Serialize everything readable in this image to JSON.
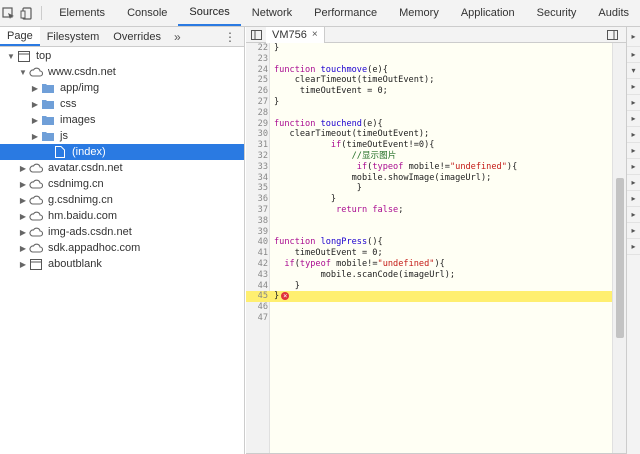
{
  "toolbar": {
    "icons": [
      "inspect-icon",
      "device-icon"
    ],
    "tabs": [
      "Elements",
      "Console",
      "Sources",
      "Network",
      "Performance",
      "Memory",
      "Application",
      "Security",
      "Audits"
    ],
    "active_tab": "Sources"
  },
  "navigator": {
    "subtabs": [
      "Page",
      "Filesystem",
      "Overrides"
    ],
    "active_subtab": "Page",
    "more": "»",
    "menu": "⋮",
    "tree": [
      {
        "label": "top",
        "depth": 0,
        "expanded": true,
        "icon": "frame-icon"
      },
      {
        "label": "www.csdn.net",
        "depth": 1,
        "expanded": true,
        "icon": "cloud-icon"
      },
      {
        "label": "app/img",
        "depth": 2,
        "expanded": false,
        "icon": "folder-icon"
      },
      {
        "label": "css",
        "depth": 2,
        "expanded": false,
        "icon": "folder-icon"
      },
      {
        "label": "images",
        "depth": 2,
        "expanded": false,
        "icon": "folder-icon"
      },
      {
        "label": "js",
        "depth": 2,
        "expanded": false,
        "icon": "folder-icon"
      },
      {
        "label": "(index)",
        "depth": 3,
        "expanded": null,
        "icon": "file-icon",
        "selected": true
      },
      {
        "label": "avatar.csdn.net",
        "depth": 1,
        "expanded": false,
        "icon": "cloud-icon"
      },
      {
        "label": "csdnimg.cn",
        "depth": 1,
        "expanded": false,
        "icon": "cloud-icon"
      },
      {
        "label": "g.csdnimg.cn",
        "depth": 1,
        "expanded": false,
        "icon": "cloud-icon"
      },
      {
        "label": "hm.baidu.com",
        "depth": 1,
        "expanded": false,
        "icon": "cloud-icon"
      },
      {
        "label": "img-ads.csdn.net",
        "depth": 1,
        "expanded": false,
        "icon": "cloud-icon"
      },
      {
        "label": "sdk.appadhoc.com",
        "depth": 1,
        "expanded": false,
        "icon": "cloud-icon"
      },
      {
        "label": "aboutblank",
        "depth": 1,
        "expanded": false,
        "icon": "frame-icon"
      }
    ]
  },
  "editor": {
    "file_tab": "VM756",
    "close": "×",
    "lines": [
      {
        "n": "22",
        "code": "}"
      },
      {
        "n": "23",
        "code": ""
      },
      {
        "n": "24",
        "code": "function touchmove(e){"
      },
      {
        "n": "25",
        "code": "    clearTimeout(timeOutEvent);"
      },
      {
        "n": "26",
        "code": "     timeOutEvent = 0;"
      },
      {
        "n": "27",
        "code": "}"
      },
      {
        "n": "28",
        "code": ""
      },
      {
        "n": "29",
        "code": "function touchend(e){"
      },
      {
        "n": "30",
        "code": "   clearTimeout(timeOutEvent);"
      },
      {
        "n": "31",
        "code": "           if(timeOutEvent!=0){"
      },
      {
        "n": "32",
        "code": "               //显示图片"
      },
      {
        "n": "33",
        "code": "                if(typeof mobile!=\"undefined\"){"
      },
      {
        "n": "34",
        "code": "               mobile.showImage(imageUrl);"
      },
      {
        "n": "35",
        "code": "                }"
      },
      {
        "n": "36",
        "code": "           }"
      },
      {
        "n": "37",
        "code": "            return false;"
      },
      {
        "n": "38",
        "code": ""
      },
      {
        "n": "39",
        "code": ""
      },
      {
        "n": "40",
        "code": "function longPress(){"
      },
      {
        "n": "41",
        "code": "    timeOutEvent = 0;"
      },
      {
        "n": "42",
        "code": "  if(typeof mobile!=\"undefined\"){"
      },
      {
        "n": "43",
        "code": "         mobile.scanCode(imageUrl);"
      },
      {
        "n": "44",
        "code": "    }"
      },
      {
        "n": "45",
        "code": "}",
        "highlight": true,
        "error": true
      },
      {
        "n": "46",
        "code": ""
      },
      {
        "n": "47",
        "code": ""
      }
    ]
  },
  "colors": {
    "accent": "#2a7ae2",
    "editor_bg": "#fffff4",
    "highlight": "#ffef70",
    "error": "#e0323c"
  }
}
